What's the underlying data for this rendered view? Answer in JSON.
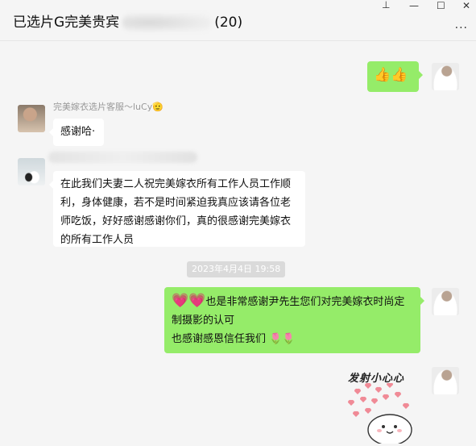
{
  "window": {
    "title_prefix": "已选片G完美贵宾",
    "member_count": "(20)",
    "pin_glyph": "⊥",
    "minimize_glyph": "—",
    "maximize_glyph": "☐",
    "close_glyph": "✕",
    "more_glyph": "···"
  },
  "messages": [
    {
      "side": "right",
      "text": "👍👍"
    },
    {
      "side": "left",
      "sender": "完美嫁衣选片客服～luCy🫡",
      "text": "感谢哈·"
    },
    {
      "side": "left",
      "text": "在此我们夫妻二人祝完美嫁衣所有工作人员工作顺利，身体健康，若不是时间紧迫我真应该请各位老师吃饭，好好感谢感谢你们，真的很感谢完美嫁衣的所有工作人员"
    },
    {
      "timestamp": "2023年4月4日 19:58"
    },
    {
      "side": "right",
      "emoji_lead": "💗💗",
      "line1": "也是非常感谢尹先生您们对完美嫁衣时尚定制摄影的认可",
      "line2": "也感谢感恩信任我们",
      "emoji_tail": "🌷🌷"
    },
    {
      "side": "right",
      "sticker": "发射小心心"
    }
  ],
  "colors": {
    "green_bubble": "#95ec69",
    "white_bubble": "#ffffff",
    "background": "#f5f5f5"
  }
}
